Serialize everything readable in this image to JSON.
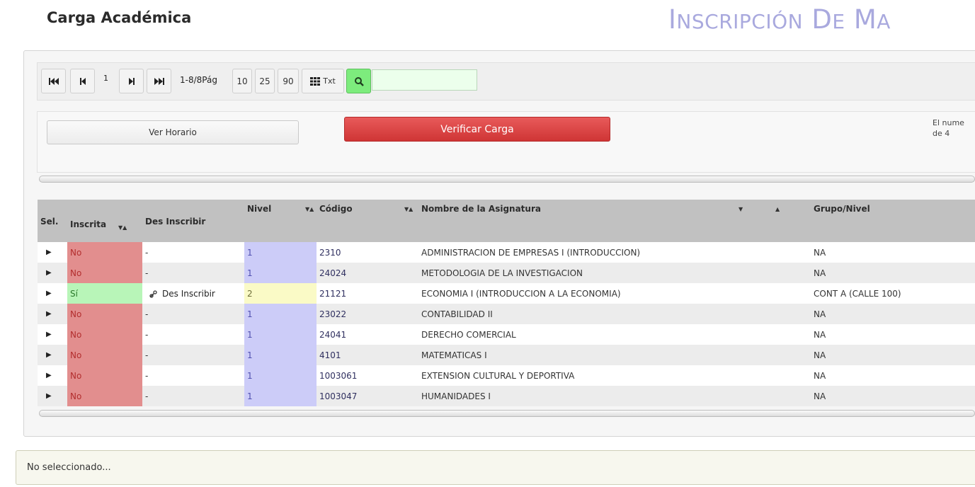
{
  "header": {
    "page_title": "Carga Académica",
    "section_title_i": "I",
    "section_title_nscripcion": "NSCRIPCIÓN",
    "section_title_d": "D",
    "section_title_e": "E",
    "section_title_m": "M",
    "section_title_a": "A"
  },
  "pager": {
    "first_icon": "first-page-icon",
    "prev_icon": "prev-page-icon",
    "current_page": "1",
    "next_icon": "next-page-icon",
    "last_icon": "last-page-icon",
    "range": "1-8/8Pág",
    "size_10": "10",
    "size_25": "25",
    "size_90": "90",
    "txt_label": "Txt",
    "search_value": ""
  },
  "actions": {
    "ver_horario": "Ver Horario",
    "verificar_carga": "Verificar Carga",
    "note_line1": "El nume",
    "note_line2": "de 4"
  },
  "grid": {
    "columns": {
      "sel": "Sel.",
      "inscrita": "Inscrita",
      "des_inscribir": "Des Inscribir",
      "nivel": "Nivel",
      "codigo": "Código",
      "nombre": "Nombre de la Asignatura",
      "grupo": "Grupo/Nivel"
    },
    "rows": [
      {
        "inscrita": "No",
        "des": "-",
        "nivel": "1",
        "codigo": "2310",
        "nombre": "ADMINISTRACION DE EMPRESAS I (INTRODUCCION)",
        "grupo": "NA"
      },
      {
        "inscrita": "No",
        "des": "-",
        "nivel": "1",
        "codigo": "24024",
        "nombre": "METODOLOGIA DE LA INVESTIGACION",
        "grupo": "NA"
      },
      {
        "inscrita": "Sí",
        "des": "Des Inscribir",
        "nivel": "2",
        "codigo": "21121",
        "nombre": "ECONOMIA I (INTRODUCCION A LA ECONOMIA)",
        "grupo": "CONT A (CALLE 100)"
      },
      {
        "inscrita": "No",
        "des": "-",
        "nivel": "1",
        "codigo": "23022",
        "nombre": "CONTABILIDAD II",
        "grupo": "NA"
      },
      {
        "inscrita": "No",
        "des": "-",
        "nivel": "1",
        "codigo": "24041",
        "nombre": "DERECHO COMERCIAL",
        "grupo": "NA"
      },
      {
        "inscrita": "No",
        "des": "-",
        "nivel": "1",
        "codigo": "4101",
        "nombre": "MATEMATICAS I",
        "grupo": "NA"
      },
      {
        "inscrita": "No",
        "des": "-",
        "nivel": "1",
        "codigo": "1003061",
        "nombre": "EXTENSION CULTURAL Y DEPORTIVA",
        "grupo": "NA"
      },
      {
        "inscrita": "No",
        "des": "-",
        "nivel": "1",
        "codigo": "1003047",
        "nombre": "HUMANIDADES I",
        "grupo": "NA"
      }
    ]
  },
  "status": {
    "text": "No seleccionado..."
  },
  "colors": {
    "no_bg": "#e28e8e",
    "si_bg": "#b8f5b8",
    "nivel1_bg": "#ccccf8",
    "nivel2_bg": "#fafac6",
    "verificar_bg": "#dc4444",
    "search_btn_bg": "#7dec7d"
  }
}
